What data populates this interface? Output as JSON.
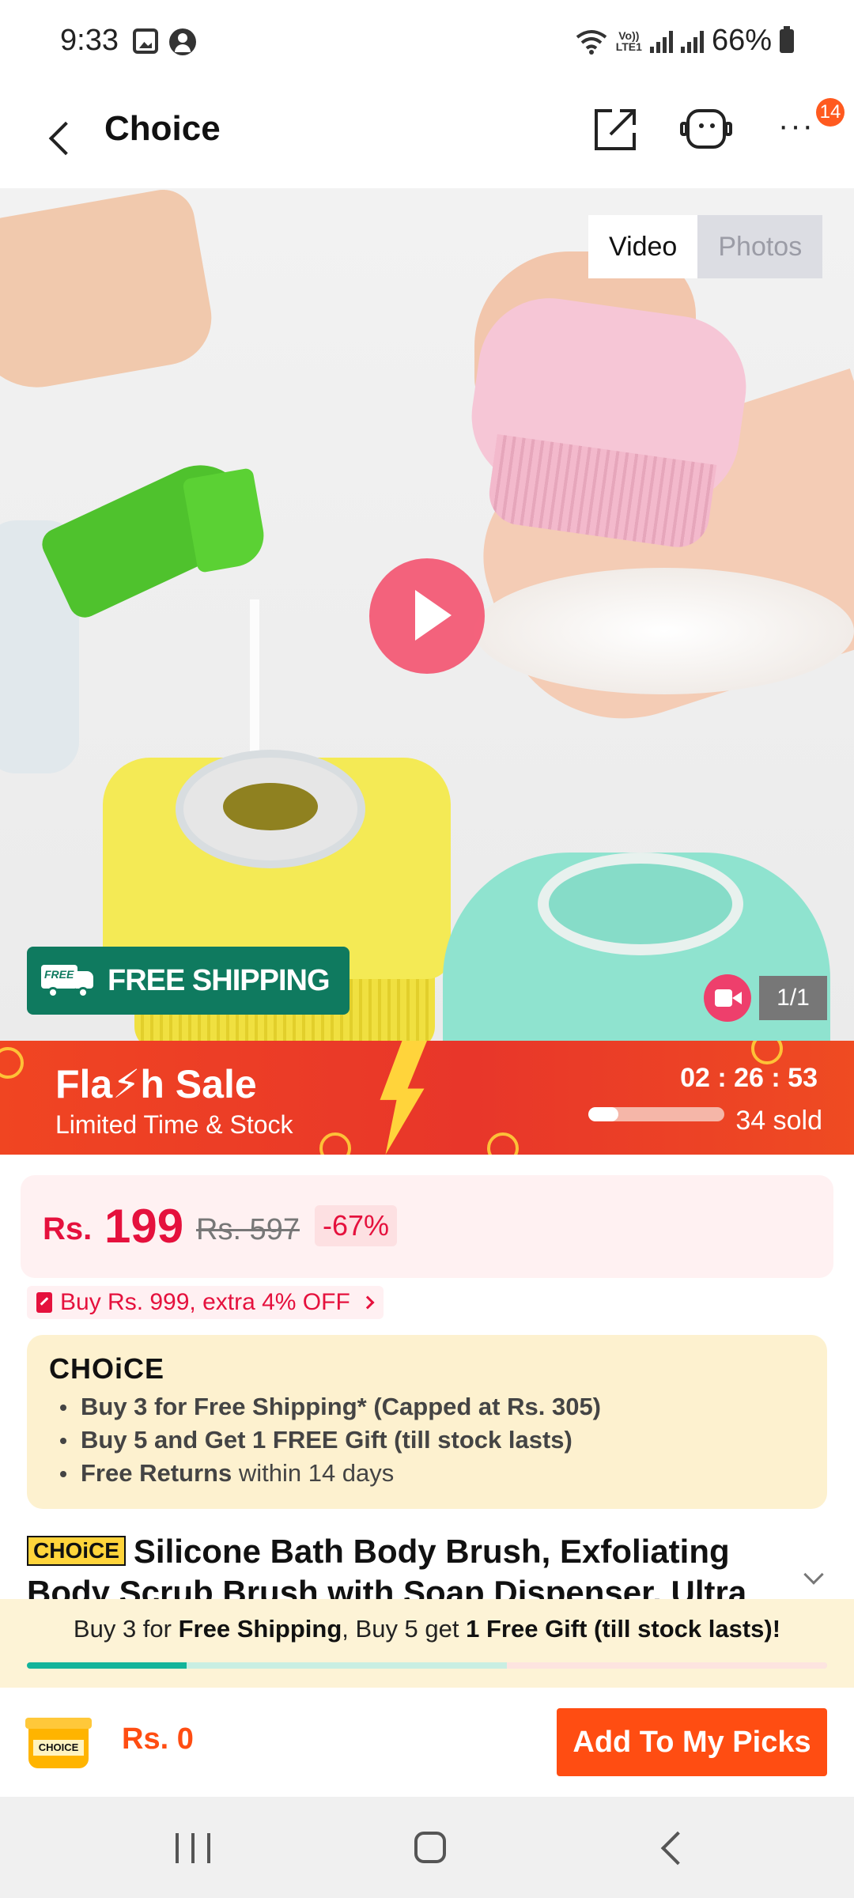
{
  "status_bar": {
    "time": "9:33",
    "network": "LTE1",
    "network_top": "Vo))",
    "battery": "66%",
    "icons": [
      "gallery-icon",
      "account-icon",
      "wifi-icon",
      "signal-icon",
      "battery-icon"
    ]
  },
  "header": {
    "title": "Choice",
    "more_badge": "14",
    "icons": [
      "back-icon",
      "share-icon",
      "customer-service-icon",
      "more-icon"
    ]
  },
  "media": {
    "tabs": [
      {
        "label": "Video",
        "active": true
      },
      {
        "label": "Photos",
        "active": false
      }
    ],
    "free_shipping_tag": "FREE",
    "free_shipping_label": "FREE SHIPPING",
    "counter": "1/1"
  },
  "flash_sale": {
    "title": "Fla⚡h Sale",
    "subtitle": "Limited Time & Stock",
    "timer": "02 : 26 : 53",
    "sold": "34 sold",
    "sold_progress": 0.22
  },
  "price": {
    "currency": "Rs.",
    "current": "199",
    "original": "Rs. 597",
    "discount": "-67%"
  },
  "promo": {
    "text": "Buy Rs. 999, extra 4% OFF"
  },
  "choice": {
    "logo": "CHOiCE",
    "items": [
      {
        "bold": "Buy 3 for  Free Shipping* (Capped at Rs. 305)",
        "rest": ""
      },
      {
        "bold": "Buy 5 and Get 1 FREE Gift (till stock lasts)",
        "rest": ""
      },
      {
        "bold": "Free Returns",
        "rest": " within 14 days"
      }
    ]
  },
  "product": {
    "badge": "CHOiCE",
    "title": "Silicone Bath Body Brush, Exfoliating Body Scrub Brush with Soap Dispenser, Ultra"
  },
  "sticky_banner": {
    "part1": "Buy 3 for ",
    "part2": "Free Shipping",
    "part3": ", Buy 5 get ",
    "part4": "1 Free Gift (till stock lasts)!",
    "progress_done": 0.2,
    "progress_next": 0.6
  },
  "bottom_bar": {
    "cart_label": "CHOICE",
    "total": "Rs. 0",
    "cta": "Add To My Picks"
  },
  "colors": {
    "accent": "#ff4d12",
    "price_red": "#e5113d",
    "choice_bg": "#fdf1cf",
    "free_ship_green": "#0f7a5f",
    "flash_red": "#e8362a"
  }
}
